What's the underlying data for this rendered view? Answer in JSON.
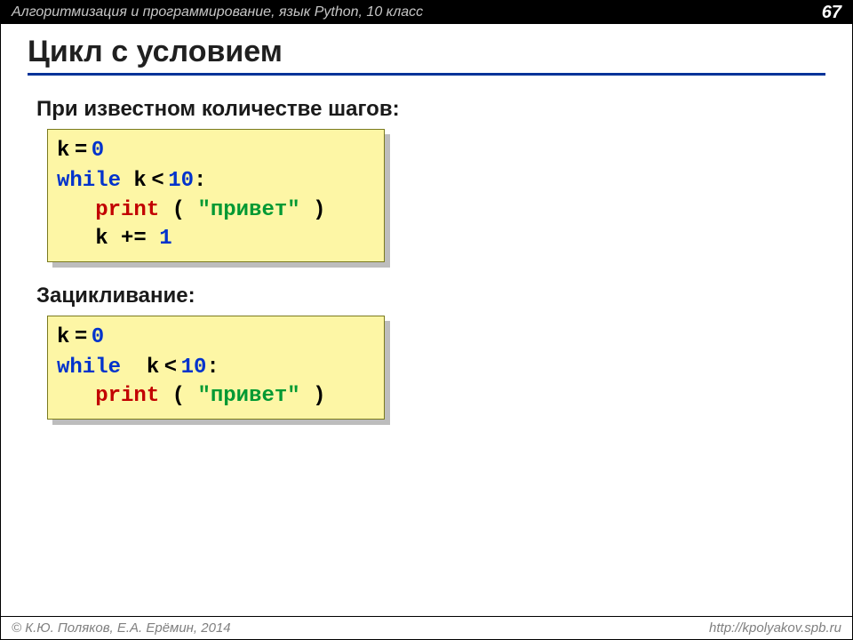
{
  "header": {
    "subject": "Алгоритмизация и программирование, язык Python, 10 класс",
    "page_number": "67"
  },
  "title": "Цикл с условием",
  "section1": {
    "heading": "При известном количестве шагов:",
    "code": {
      "l1a": "k",
      "l1eq": " = ",
      "l1b": "0",
      "l2a": "while",
      "l2b": " k",
      "l2lt": " < ",
      "l2c": "10",
      "l2d": ":",
      "l3a": "   ",
      "l3b": "print",
      "l3c": " ( ",
      "l3d": "\"привет\"",
      "l3e": " )",
      "l4a": "   k += ",
      "l4b": "1"
    }
  },
  "section2": {
    "heading": "Зацикливание:",
    "code": {
      "l1a": "k",
      "l1eq": " = ",
      "l1b": "0",
      "l2a": "while",
      "l2b": "  k",
      "l2lt": " < ",
      "l2c": "10",
      "l2d": ":",
      "l3a": "   ",
      "l3b": "print",
      "l3c": " ( ",
      "l3d": "\"привет\"",
      "l3e": " )"
    }
  },
  "footer": {
    "copyright_symbol": "©",
    "authors": " К.Ю. Поляков, Е.А. Ерёмин, 2014",
    "url": "http://kpolyakov.spb.ru"
  }
}
